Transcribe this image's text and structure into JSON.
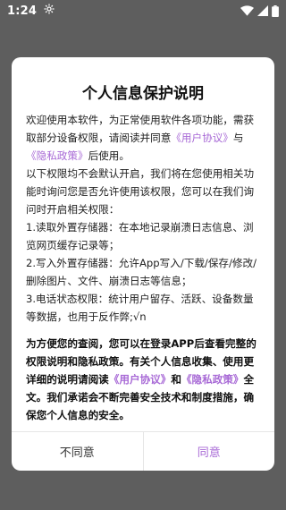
{
  "status_bar": {
    "time": "1:24",
    "icons": [
      "gear-icon",
      "wifi-icon",
      "signal-icon",
      "battery-icon"
    ]
  },
  "colors": {
    "accent": "#a86ad6",
    "overlay": "#5e5e5e",
    "dialog_bg": "#ffffff"
  },
  "dialog": {
    "title": "个人信息保护说明",
    "intro": {
      "before": "欢迎使用本软件，为正常使用软件各项功能，需获取部分设备权限，请阅读并同意",
      "link1": "《用户协议》",
      "middle": "与",
      "link2": "《隐私政策》",
      "after": "后使用。"
    },
    "notice": "以下权限均不会默认开启，我们将在您使用相关功能时询问您是否允许使用该权限，您可以在我们询问时开启相关权限：",
    "permissions": [
      "1.读取外置存储器：在本地记录崩溃日志信息、浏览网页缓存记录等；",
      "2.写入外置存储器：允许App写入/下载/保存/修改/删除图片、文件、崩溃日志等信息；",
      "3.电话状态权限：统计用户留存、活跃、设备数量等数据，也用于反作弊;√n"
    ],
    "summary": {
      "before": "为方便您的查阅，您可以在登录APP后查看完整的权限说明和隐私政策。有关个人信息收集、使用更详细的说明请阅读",
      "link1": "《用户协议》",
      "middle": "和",
      "link2": "《隐私政策》",
      "after": "全文。我们承诺会不断完善安全技术和制度措施，确保您个人信息的安全。"
    },
    "buttons": {
      "disagree": "不同意",
      "agree": "同意"
    }
  }
}
